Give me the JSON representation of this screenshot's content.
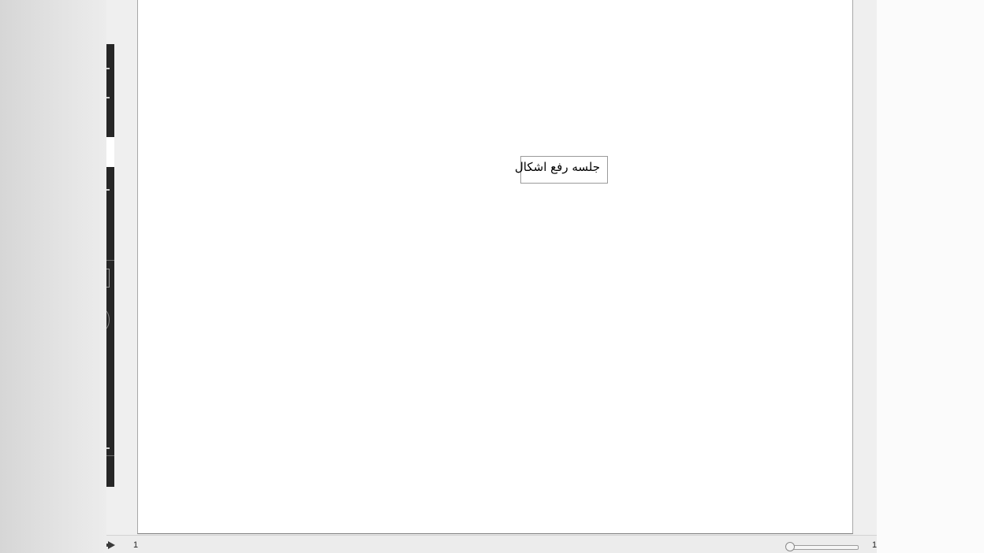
{
  "canvas": {
    "text_box_content": "جلسه رفع اشکال"
  },
  "status_bar": {
    "page_number": "1",
    "zoom_value": "1",
    "zoom_slider_level_fraction": 0.0,
    "play_icon": "play-icon"
  },
  "colors": {
    "toolbar": "#262626",
    "workspace": "#efefef",
    "page": "#ffffff"
  }
}
